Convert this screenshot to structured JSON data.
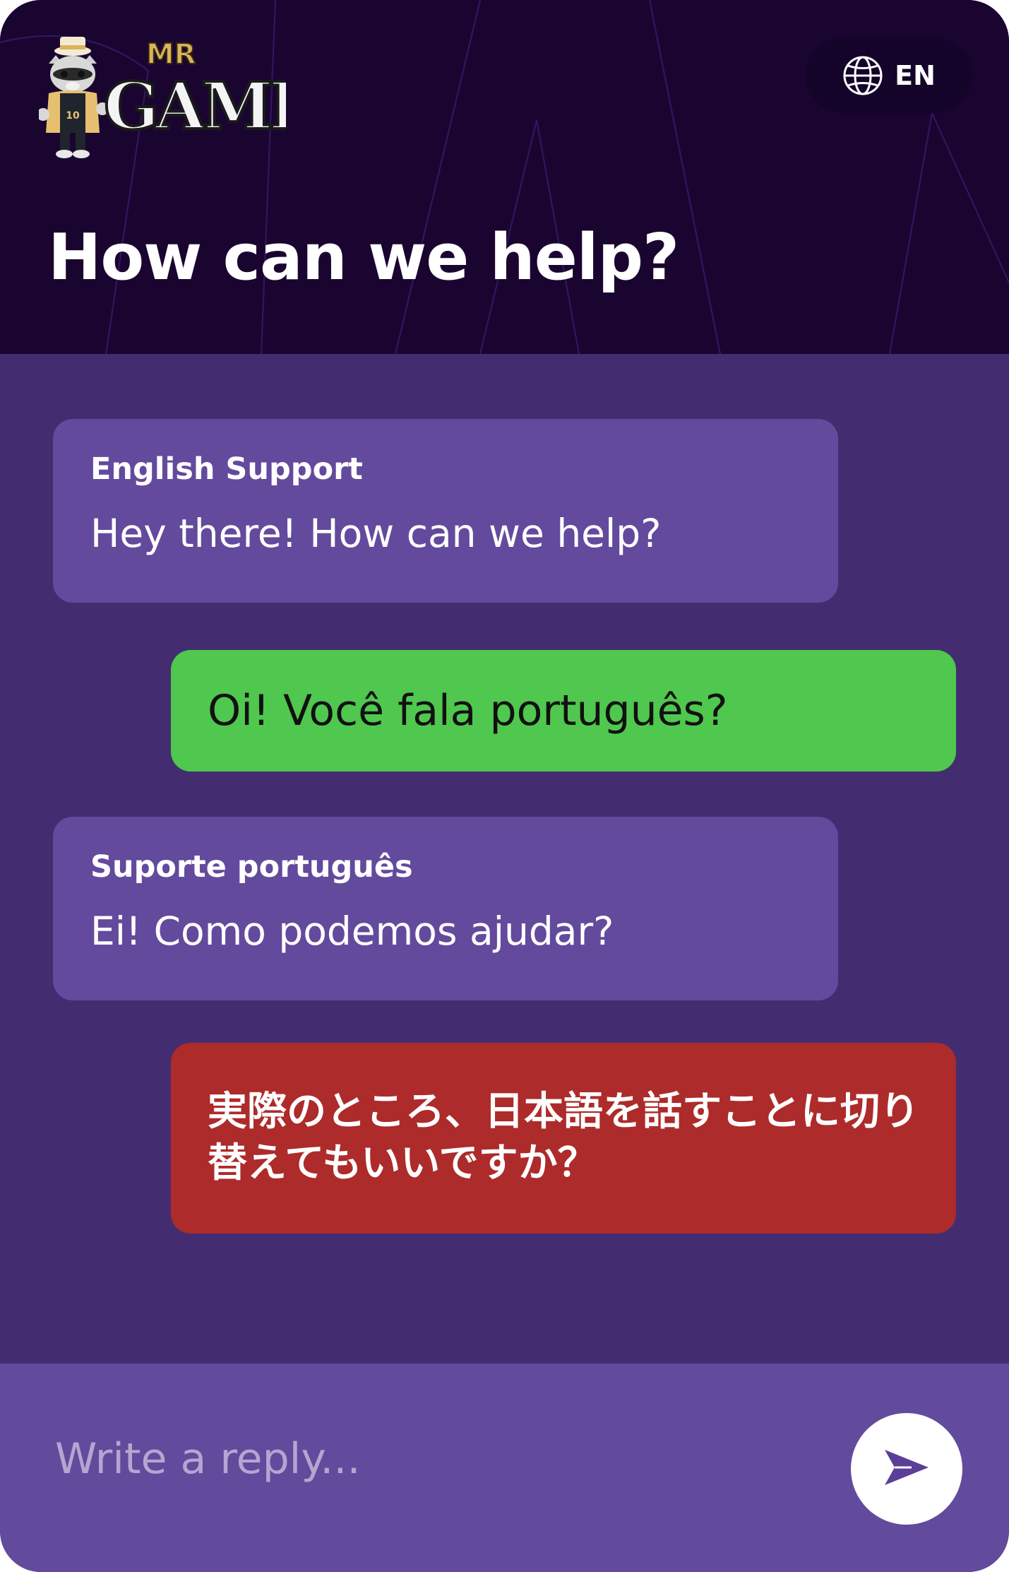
{
  "header": {
    "brand": "MR GAMB",
    "language_code": "EN",
    "title": "How can we help?"
  },
  "messages": [
    {
      "role": "agent",
      "sender": "English Support",
      "text": "Hey there! How can we help?"
    },
    {
      "role": "user",
      "text": "Oi! Você fala português?"
    },
    {
      "role": "agent",
      "sender": "Suporte português",
      "text": "Ei! Como podemos ajudar?"
    },
    {
      "role": "user",
      "text": "実際のところ、日本語を話すことに切り替えてもいいですか？"
    }
  ],
  "composer": {
    "placeholder": "Write a reply...",
    "value": ""
  },
  "icons": {
    "language": "globe-icon",
    "send": "send-icon",
    "logo": "raccoon-mascot-logo"
  },
  "colors": {
    "header_bg": "#1a0530",
    "chat_bg": "#432d70",
    "agent_bubble": "#634a9d",
    "user_bubble_1": "#50c74e",
    "user_bubble_2": "#ad2b2b",
    "composer_bg": "#624a9c",
    "logo_gold": "#d9b45c"
  }
}
